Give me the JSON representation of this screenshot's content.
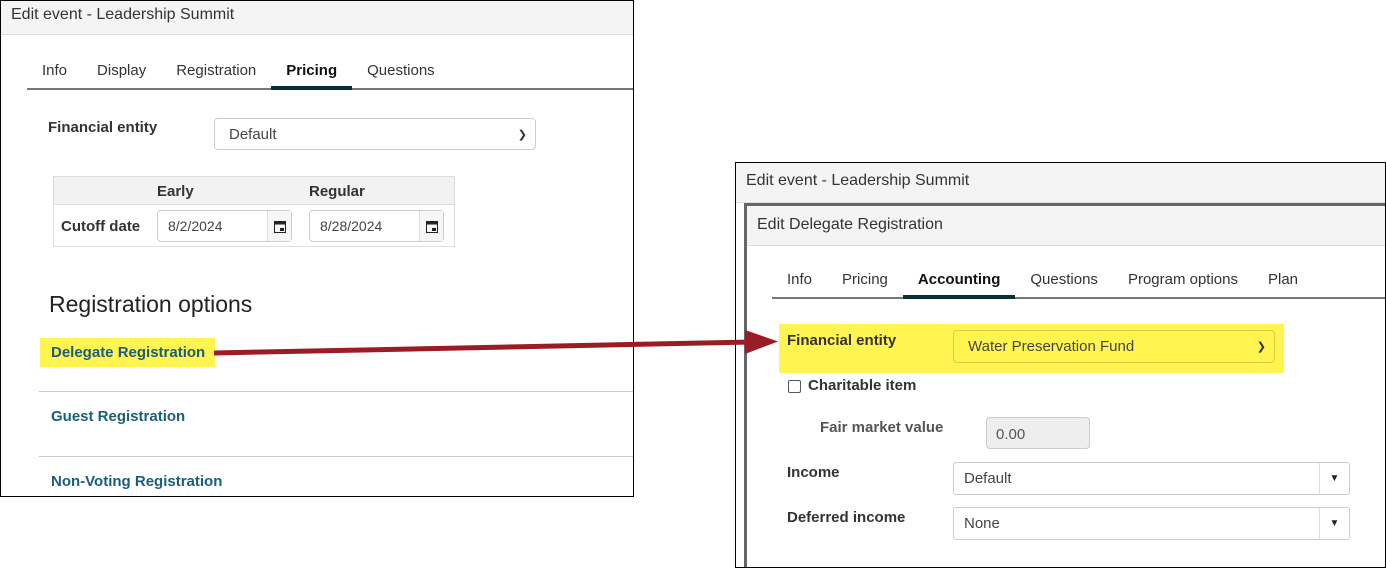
{
  "left_panel": {
    "title": "Edit event - Leadership Summit",
    "tabs": [
      "Info",
      "Display",
      "Registration",
      "Pricing",
      "Questions"
    ],
    "active_tab": "Pricing",
    "financial_entity_label": "Financial entity",
    "financial_entity_value": "Default",
    "pricing_table": {
      "columns": [
        "Early",
        "Regular"
      ],
      "row_label": "Cutoff date",
      "dates": [
        "8/2/2024",
        "8/28/2024"
      ]
    },
    "section_title": "Registration options",
    "options": [
      "Delegate Registration",
      "Guest Registration",
      "Non-Voting Registration"
    ]
  },
  "right_panel": {
    "title": "Edit event - Leadership Summit",
    "dialog_title": "Edit Delegate Registration",
    "tabs": [
      "Info",
      "Pricing",
      "Accounting",
      "Questions",
      "Program options",
      "Plan"
    ],
    "active_tab": "Accounting",
    "financial_entity_label": "Financial entity",
    "financial_entity_value": "Water Preservation Fund",
    "charitable_label": "Charitable item",
    "charitable_checked": false,
    "fair_market_label": "Fair market value",
    "fair_market_value": "0.00",
    "income_label": "Income",
    "income_value": "Default",
    "deferred_label": "Deferred income",
    "deferred_value": "None"
  },
  "colors": {
    "highlight": "#fff450",
    "arrow": "#9b1c24",
    "link": "#1b5e7a",
    "tab_underline": "#0c2f36"
  }
}
